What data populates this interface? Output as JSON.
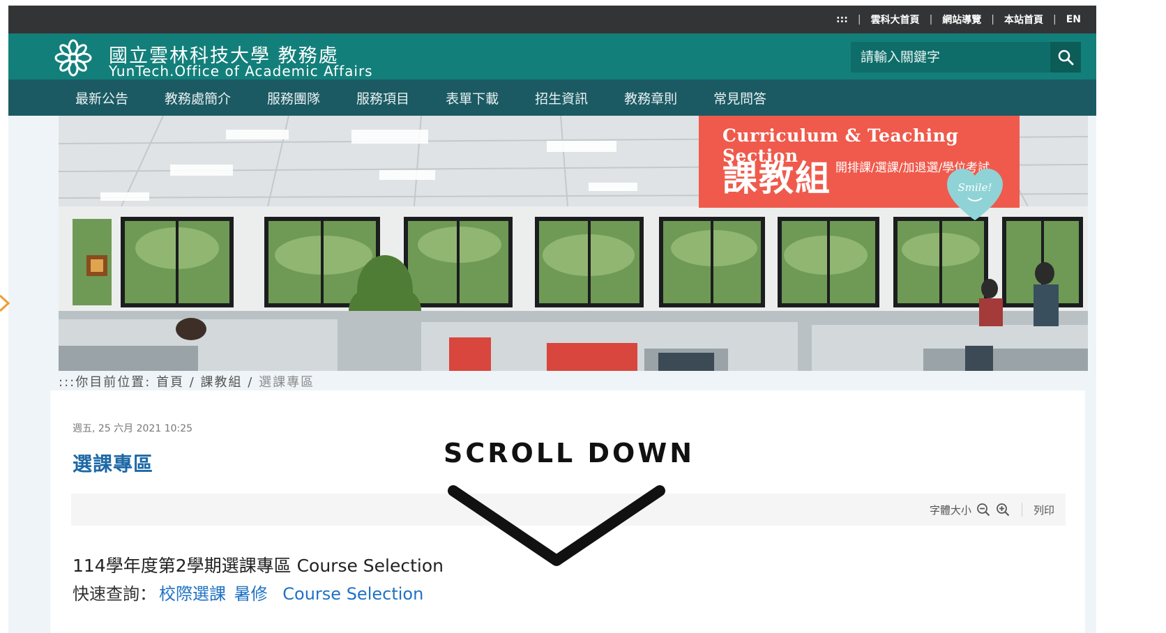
{
  "util_links": [
    "雲科大首頁",
    "網站導覽",
    "本站首頁",
    "EN"
  ],
  "util_access": ":::",
  "header": {
    "title_zh": "國立雲林科技大學 教務處",
    "title_en": "YunTech.Office of Academic Affairs"
  },
  "search": {
    "placeholder": "請輸入關鍵字"
  },
  "nav": [
    "最新公告",
    "教務處簡介",
    "服務團隊",
    "服務項目",
    "表單下載",
    "招生資訊",
    "教務章則",
    "常見問答"
  ],
  "banner": {
    "sign_en": "Curriculum & Teaching Section",
    "sign_zh": "課教組",
    "sign_sub": "開排課/選課/加退選/學位考試",
    "heart_text": "Smile!"
  },
  "breadcrumb": {
    "prefix": ":::你目前位置:",
    "items": [
      "首頁",
      "課教組"
    ],
    "current": "選課專區",
    "separator": "/"
  },
  "article": {
    "date": "週五, 25 六月 2021 10:25",
    "title": "選課專區",
    "font_size_label": "字體大小",
    "print_label": "列印",
    "heading": "114學年度第2學期選課專區 Course Selection",
    "quick_label": "快速查詢：",
    "quick_links": [
      "校際選課",
      "暑修",
      "Course Selection"
    ]
  },
  "overlay": {
    "scroll_text": "SCROLL DOWN"
  },
  "colors": {
    "header": "#137f7a",
    "nav": "#1c5a63",
    "utilbar": "#333436",
    "title": "#1d68a6",
    "link": "#1f72c4",
    "sign": "#ef5a4c"
  },
  "icons": {
    "search": "search-icon",
    "zoom_out": "zoom-out-icon",
    "zoom_in": "zoom-in-icon",
    "logo": "university-logo-icon",
    "chevron": "chevron-down-icon"
  }
}
